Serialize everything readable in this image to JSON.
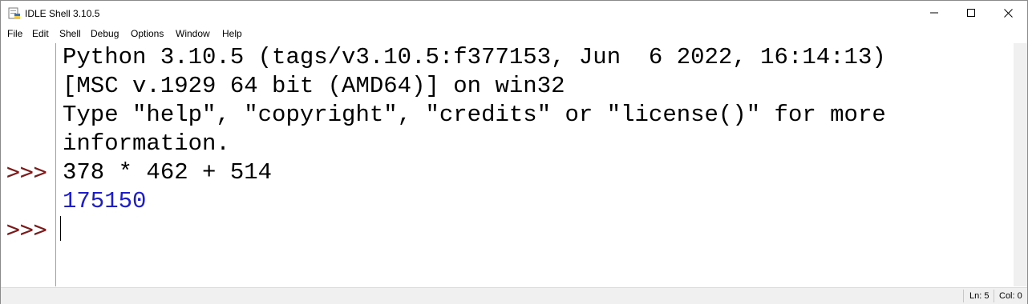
{
  "window": {
    "title": "IDLE Shell 3.10.5"
  },
  "menu": [
    "File",
    "Edit",
    "Shell",
    "Debug",
    "Options",
    "Window",
    "Help"
  ],
  "shell": {
    "lines": [
      "Python 3.10.5 (tags/v3.10.5:f377153, Jun  6 2022, 16:14:13)",
      "[MSC v.1929 64 bit (AMD64)] on win32",
      "Type \"help\", \"copyright\", \"credits\" or \"license()\" for more",
      "information.",
      "378 * 462 + 514",
      "175150"
    ],
    "prompt": ">>>"
  },
  "status": {
    "line": "Ln: 5",
    "col": "Col: 0"
  },
  "colors": {
    "prompt": "#7a1a1a",
    "output": "#1b1bd8"
  }
}
